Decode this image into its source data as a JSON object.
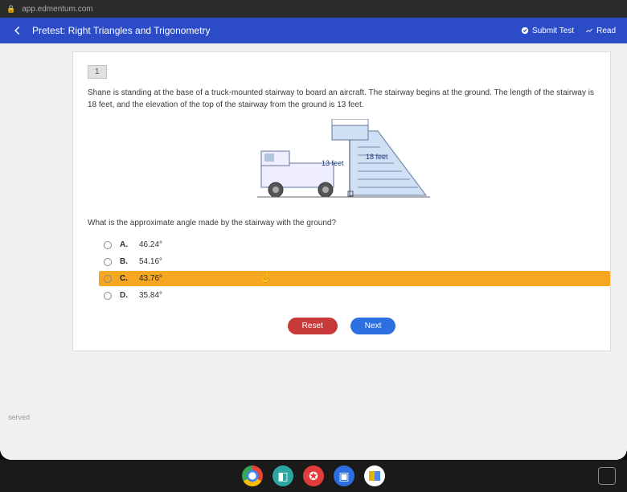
{
  "browser": {
    "secure": "🔒",
    "url": "app.edmentum.com"
  },
  "header": {
    "title": "Pretest: Right Triangles and Trigonometry",
    "submit": "Submit Test",
    "reader": "Read"
  },
  "question": {
    "number": "1",
    "text_line1": "Shane is standing at the base of a truck-mounted stairway to board an aircraft. The stairway begins at the ground. The length of the stairway is",
    "text_line2": "18 feet, and the elevation of the top of the stairway from the ground is 13 feet.",
    "label_height": "13 feet",
    "label_hyp": "18 feet",
    "prompt": "What is the approximate angle made by the stairway with the ground?",
    "options": {
      "a": {
        "letter": "A.",
        "value": "46.24°"
      },
      "b": {
        "letter": "B.",
        "value": "54.16°"
      },
      "c": {
        "letter": "C.",
        "value": "43.76°"
      },
      "d": {
        "letter": "D.",
        "value": "35.84°"
      }
    },
    "reset": "Reset",
    "next": "Next"
  },
  "footnote": "served"
}
